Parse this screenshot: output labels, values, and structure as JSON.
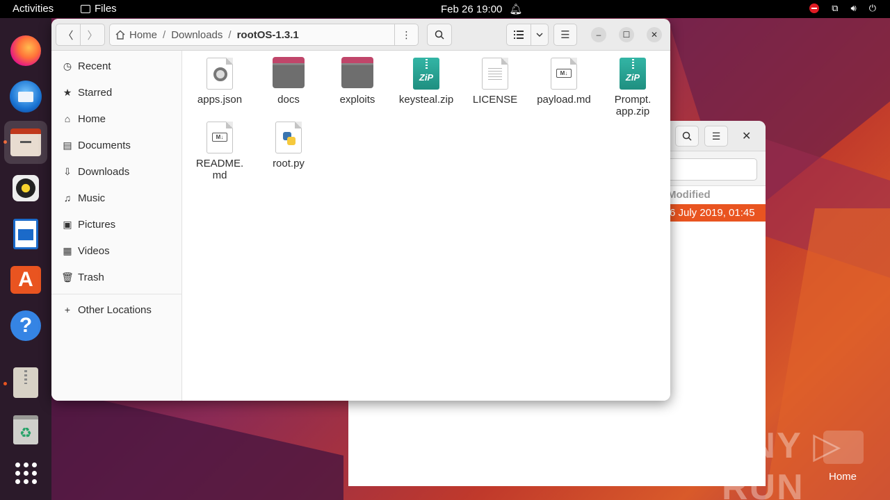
{
  "topbar": {
    "activities": "Activities",
    "app_name": "Files",
    "clock": "Feb 26  19:00"
  },
  "dock": {
    "items": [
      "firefox-icon",
      "thunderbird-icon",
      "files-icon",
      "rhythmbox-icon",
      "writer-icon",
      "app-center-icon",
      "help-icon",
      "archive-manager-icon",
      "trash-icon",
      "show-apps-icon"
    ]
  },
  "window": {
    "path": {
      "home": "Home",
      "seg1": "Downloads",
      "current": "rootOS-1.3.1"
    }
  },
  "sidebar": {
    "items": [
      {
        "label": "Recent",
        "icon": "clock-icon"
      },
      {
        "label": "Starred",
        "icon": "star-icon"
      },
      {
        "label": "Home",
        "icon": "home-icon"
      },
      {
        "label": "Documents",
        "icon": "document-icon"
      },
      {
        "label": "Downloads",
        "icon": "download-icon"
      },
      {
        "label": "Music",
        "icon": "music-icon"
      },
      {
        "label": "Pictures",
        "icon": "picture-icon"
      },
      {
        "label": "Videos",
        "icon": "video-icon"
      },
      {
        "label": "Trash",
        "icon": "trash-icon"
      }
    ],
    "other": "Other Locations"
  },
  "files": [
    {
      "name": "apps.json",
      "type": "json"
    },
    {
      "name": "docs",
      "type": "folder"
    },
    {
      "name": "exploits",
      "type": "folder"
    },
    {
      "name": "keysteal.zip",
      "type": "zip"
    },
    {
      "name": "LICENSE",
      "type": "text"
    },
    {
      "name": "payload.md",
      "type": "markdown"
    },
    {
      "name": "Prompt.\napp.zip",
      "type": "zip"
    },
    {
      "name": "README.\nmd",
      "type": "markdown"
    },
    {
      "name": "root.py",
      "type": "python"
    }
  ],
  "bg_window": {
    "column_header": "Modified",
    "selected_row_date": "6 July 2019, 01:45"
  },
  "watermark": "ANY ▷ RUN",
  "desktop_icon_label": "Home",
  "colors": {
    "accent": "#e95420",
    "topbar": "#000000"
  }
}
